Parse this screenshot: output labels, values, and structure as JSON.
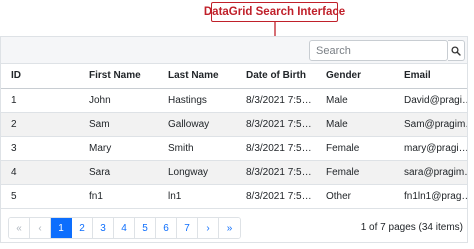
{
  "annotation": {
    "label": "DataGrid Search Interface"
  },
  "toolbar": {
    "search_placeholder": "Search",
    "search_value": "",
    "search_icon": "search-icon"
  },
  "grid": {
    "columns": [
      "ID",
      "First Name",
      "Last Name",
      "Date of Birth",
      "Gender",
      "Email"
    ],
    "rows": [
      [
        "1",
        "John",
        "Hastings",
        "8/3/2021 7:5…",
        "Male",
        "David@pragi…"
      ],
      [
        "2",
        "Sam",
        "Galloway",
        "8/3/2021 7:5…",
        "Male",
        "Sam@pragim…"
      ],
      [
        "3",
        "Mary",
        "Smith",
        "8/3/2021 7:5…",
        "Female",
        "mary@pragi…"
      ],
      [
        "4",
        "Sara",
        "Longway",
        "8/3/2021 7:5…",
        "Female",
        "sara@pragim…"
      ],
      [
        "5",
        "fn1",
        "ln1",
        "8/3/2021 7:5…",
        "Other",
        "fn1ln1@prag…"
      ]
    ]
  },
  "pager": {
    "first": "«",
    "prev": "‹",
    "next": "›",
    "last": "»",
    "pages": [
      "1",
      "2",
      "3",
      "4",
      "5",
      "6",
      "7"
    ],
    "current_page": "1",
    "summary": "1 of 7 pages (34 items)"
  },
  "colors": {
    "accent": "#0d6efd",
    "annotation": "#c0202a",
    "toolbar_bg": "#f5f6f8",
    "alt_row": "#f2f2f2"
  }
}
